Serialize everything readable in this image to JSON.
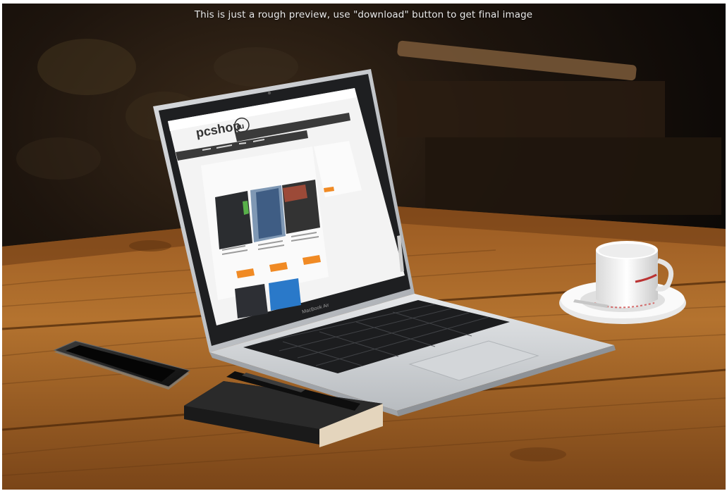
{
  "overlay": {
    "preview_note": "This is just a rough preview, use \"download\" button to get final image"
  },
  "screen_site": {
    "logo_text": "pcshop",
    "logo_badge": "ru",
    "laptop_label": "MacBook Air"
  },
  "colors": {
    "accent_orange": "#f08a24",
    "nav_dark": "#3a3a3a",
    "table_wood": "#b06c2c",
    "background_dark": "#120d09"
  }
}
